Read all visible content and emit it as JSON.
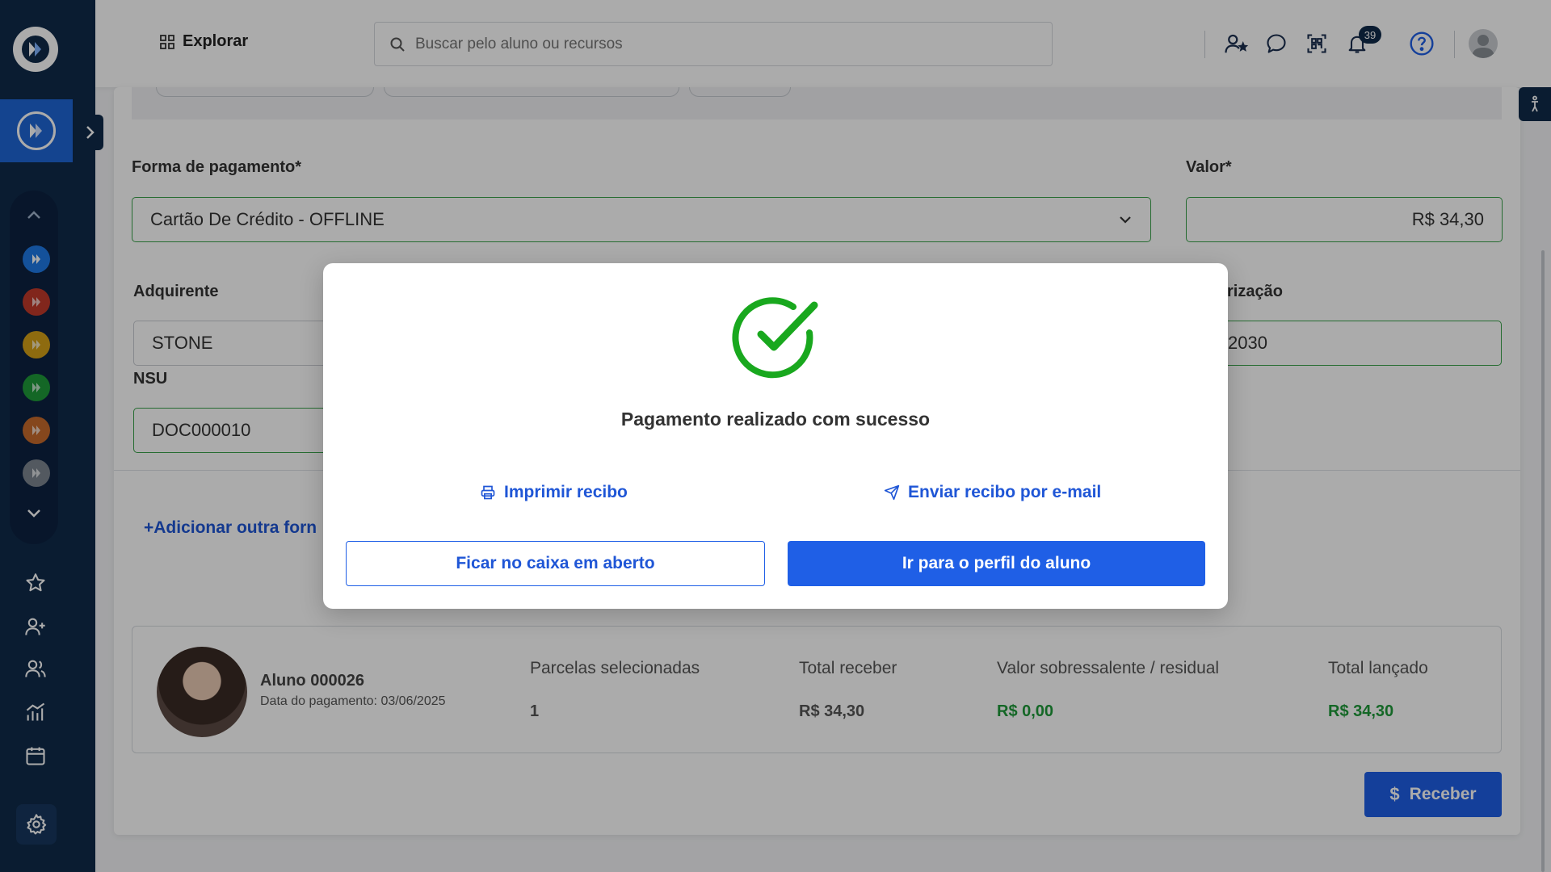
{
  "header": {
    "explore_label": "Explorar",
    "search_placeholder": "Buscar pelo aluno ou recursos",
    "notifications_count": "39"
  },
  "payment_form": {
    "method_label": "Forma de pagamento*",
    "method_value": "Cartão De Crédito - OFFLINE",
    "amount_label": "Valor*",
    "amount_value": "R$ 34,30",
    "acquirer_label": "Adquirente",
    "acquirer_value": "STONE",
    "authorization_label_partial": "rização",
    "authorization_value_partial": "2030",
    "nsu_label": "NSU",
    "nsu_value": "DOC000010",
    "add_other_partial": "+Adicionar outra forn"
  },
  "summary": {
    "student_name": "Aluno 000026",
    "payment_date": "Data do pagamento: 03/06/2025",
    "columns": [
      {
        "header": "Parcelas selecionadas",
        "value": "1"
      },
      {
        "header": "Total receber",
        "value": "R$ 34,30"
      },
      {
        "header": "Valor sobressalente / residual",
        "value": "R$ 0,00"
      },
      {
        "header": "Total lançado",
        "value": "R$ 34,30"
      }
    ],
    "receive_button": "Receber"
  },
  "modal": {
    "title": "Pagamento realizado com sucesso",
    "print_receipt": "Imprimir recibo",
    "email_receipt": "Enviar recibo por e-mail",
    "stay_button": "Ficar no caixa em aberto",
    "profile_button": "Ir para o perfil do aluno"
  },
  "colors": {
    "sidebar": "#0f2a4a",
    "primary": "#1f5fe6",
    "success": "#1f9a3a",
    "check": "#19a81e"
  }
}
